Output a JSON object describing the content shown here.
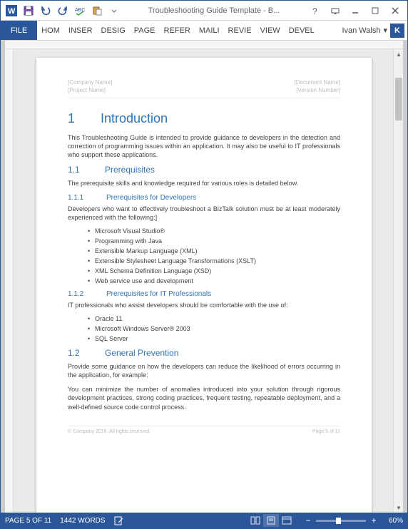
{
  "titlebar": {
    "title": "Troubleshooting Guide Template - B..."
  },
  "ribbon": {
    "file": "FILE",
    "tabs": [
      "HOM",
      "INSER",
      "DESIG",
      "PAGE",
      "REFER",
      "MAILI",
      "REVIE",
      "VIEW",
      "DEVEL"
    ],
    "user": "Ivan Walsh",
    "user_initial": "K"
  },
  "doc": {
    "header": {
      "left": [
        "[Company Name]",
        "[Project Name]"
      ],
      "right": [
        "[Document Name]",
        "[Version Number]"
      ]
    },
    "h1_num": "1",
    "h1_text": "Introduction",
    "intro_p": "This Troubleshooting Guide is intended to provide guidance to developers in the detection and correction of programming issues within an application. It may also be useful to IT professionals who support these applications.",
    "s11_num": "1.1",
    "s11_title": "Prerequisites",
    "s11_p": "The prerequisite skills and knowledge required for various roles is detailed below.",
    "s111_num": "1.1.1",
    "s111_title": "Prerequisites for Developers",
    "s111_p": "Developers who want to effectively troubleshoot a BizTalk solution must be at least moderately experienced with the following:]",
    "s111_bullets": [
      "Microsoft Visual Studio®",
      "Programming with Java",
      "Extensible Markup Language (XML)",
      "Extensible Stylesheet Language Transformations (XSLT)",
      "XML Schema Definition Language (XSD)",
      "Web service use and development"
    ],
    "s112_num": "1.1.2",
    "s112_title": "Prerequisites for IT Professionals",
    "s112_p": "IT professionals who assist developers should be comfortable with the use of:",
    "s112_bullets": [
      "Oracle 11",
      "Microsoft Windows Server® 2003",
      "SQL Server"
    ],
    "s12_num": "1.2",
    "s12_title": "General Prevention",
    "s12_p1": "Provide some guidance on how the developers can reduce the likelihood of errors occurring in the application, for example:",
    "s12_p2": "You can minimize the number of anomalies introduced into your solution through rigorous development practices, strong coding practices, frequent testing, repeatable deployment, and a well-defined source code control process.",
    "footer": {
      "left": "© Company 2016. All rights reserved.",
      "right": "Page 5 of 11"
    }
  },
  "status": {
    "page": "PAGE 5 OF 11",
    "words": "1442 WORDS",
    "zoom": "60%"
  }
}
